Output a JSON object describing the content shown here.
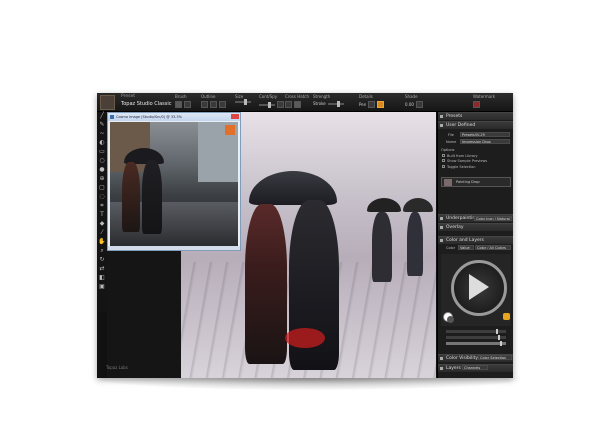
{
  "app": {
    "preset_label": "Preset",
    "preset_value": "Topaz Studio Classic",
    "watermark": "Topaz Labs"
  },
  "toolbar": {
    "groups": [
      {
        "label": "Brush"
      },
      {
        "label": "Outline"
      },
      {
        "label": "Size"
      },
      {
        "label": "Cont/Spy"
      },
      {
        "label": "Cross Hatch"
      },
      {
        "label": "Strength"
      },
      {
        "label": "Details"
      },
      {
        "label": "Shade"
      },
      {
        "label": "Watermark"
      }
    ],
    "strength_value": "Stroke",
    "details_value": "Pen",
    "shade_value": "Details More",
    "shade_num": "0.00"
  },
  "source_window": {
    "title": "Cosmo Image (Studio/Src/0) @ 33.3%"
  },
  "right_panel": {
    "presets_header": "Presets",
    "user_defined_header": "User Defined",
    "file_label": "File",
    "file_value": "Presets/IV-29",
    "name_label": "Name",
    "name_value": "Impression Drop",
    "options_label": "Options",
    "opt1": "Built from Library",
    "opt2": "Show Sample Previews",
    "toggle_label": "Toggle Selection",
    "preset_thumb_label": "Painting Drop",
    "underpainting_header": "Underpainting",
    "underpainting_value": "Color Icon / Natural",
    "overlay_header": "Overlay",
    "color_layers_header": "Color and Layers",
    "color_label": "Color",
    "color_mode": "Value",
    "color_value": "Color / All Colors",
    "color_visibility_header": "Color Visibility",
    "color_visibility_value": "Color Selection",
    "layers_header": "Layers",
    "layers_value": "Channels"
  },
  "colors": {
    "accent": "#e8a51e",
    "panel_bg": "#1d1d1d",
    "topbar_bg": "#1f1f1f"
  }
}
